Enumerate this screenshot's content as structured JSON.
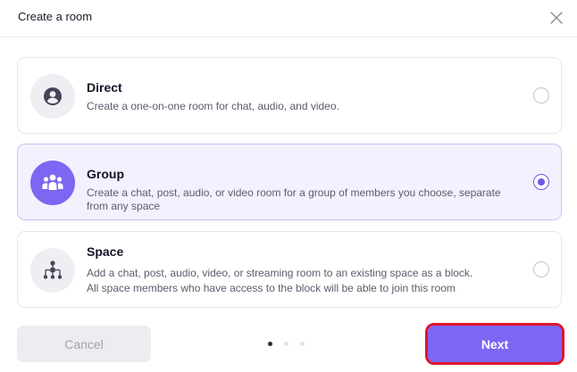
{
  "dialog": {
    "title": "Create a room"
  },
  "options": [
    {
      "id": "direct",
      "title": "Direct",
      "description": "Create a one-on-one room for chat, audio, and video.",
      "icon": "person-icon",
      "selected": false
    },
    {
      "id": "group",
      "title": "Group",
      "description": "Create a chat, post, audio, or video room for a group of members you choose, separate from any space",
      "icon": "group-icon",
      "selected": true
    },
    {
      "id": "space",
      "title": "Space",
      "description_line1": "Add a chat, post, audio, video, or streaming room to an existing space as a block.",
      "description_line2": "All space members who have access to the block will be able to join this room",
      "icon": "hierarchy-icon",
      "selected": false
    }
  ],
  "footer": {
    "cancel_label": "Cancel",
    "next_label": "Next",
    "page_current": 1,
    "page_total": 3
  },
  "colors": {
    "accent": "#7b67f3",
    "selected_bg": "#f3f1fe",
    "highlight_outline": "#e0152f"
  }
}
